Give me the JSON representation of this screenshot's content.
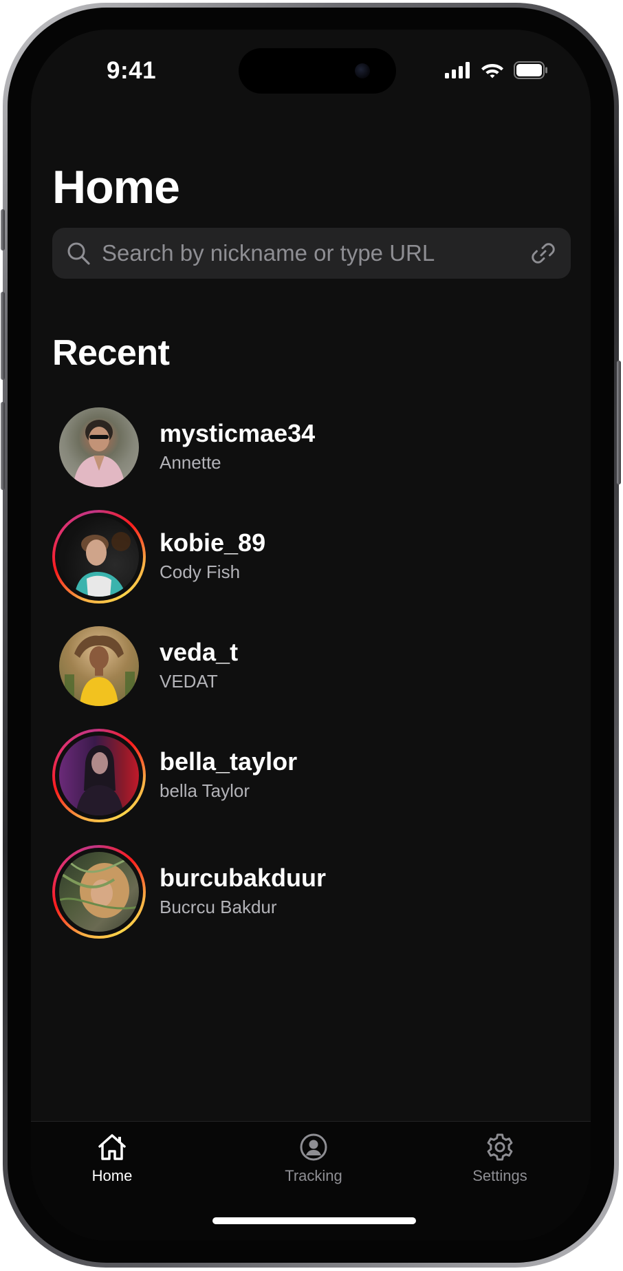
{
  "status_bar": {
    "time": "9:41",
    "icons": [
      "cellular-signal-icon",
      "wifi-icon",
      "battery-icon"
    ]
  },
  "header": {
    "title": "Home"
  },
  "search": {
    "placeholder": "Search by nickname or type URL",
    "value": "",
    "leading_icon": "search-icon",
    "trailing_icon": "link-icon"
  },
  "recent": {
    "title": "Recent",
    "items": [
      {
        "username": "mysticmae34",
        "name": "Annette",
        "has_story_ring": false
      },
      {
        "username": "kobie_89",
        "name": "Cody Fish",
        "has_story_ring": true
      },
      {
        "username": "veda_t",
        "name": "VEDAT",
        "has_story_ring": false
      },
      {
        "username": "bella_taylor",
        "name": "bella Taylor",
        "has_story_ring": true
      },
      {
        "username": "burcubakduur",
        "name": "Bucrcu Bakdur",
        "has_story_ring": true
      }
    ]
  },
  "tabbar": {
    "tabs": [
      {
        "label": "Home",
        "icon": "home-icon",
        "active": true
      },
      {
        "label": "Tracking",
        "icon": "person-circle-icon",
        "active": false
      },
      {
        "label": "Settings",
        "icon": "gear-icon",
        "active": false
      }
    ]
  },
  "colors": {
    "background": "#0f0f0f",
    "search_field": "#232324",
    "secondary_text": "#b3b3b8",
    "tab_inactive": "#8e8e93",
    "story_ring_start": "#e1306c",
    "story_ring_end": "#fcb045"
  }
}
